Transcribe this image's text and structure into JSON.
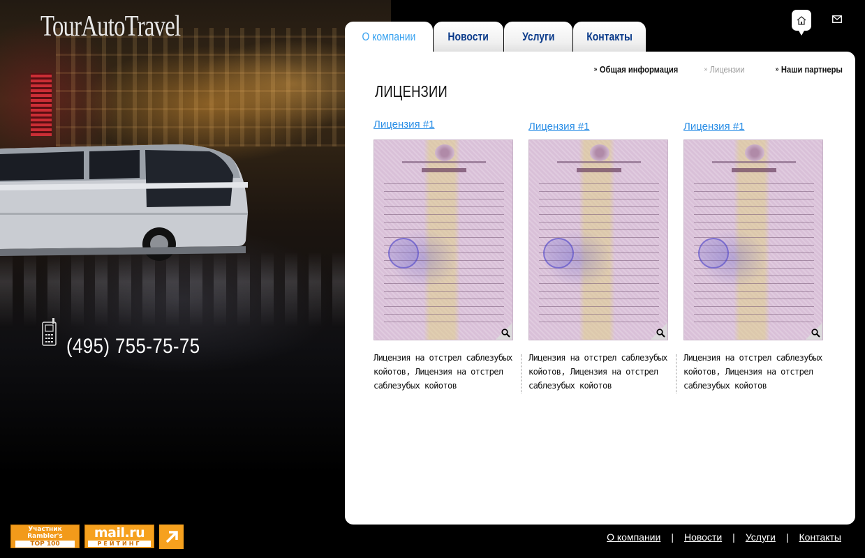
{
  "site": {
    "logo": "TourAutoTravel",
    "phone": "(495) 755-75-75"
  },
  "top_icons": {
    "home": "home-icon",
    "mail": "mail-icon"
  },
  "tabs": [
    {
      "label": "О компании",
      "active": true
    },
    {
      "label": "Новости",
      "active": false
    },
    {
      "label": "Услуги",
      "active": false
    },
    {
      "label": "Контакты",
      "active": false
    }
  ],
  "subnav": [
    {
      "label": "Общая информация",
      "active": true
    },
    {
      "label": "Лицензии",
      "active": false
    },
    {
      "label": "Наши партнеры",
      "active": true
    }
  ],
  "page": {
    "title": "ЛИЦЕНЗИИ"
  },
  "licenses": [
    {
      "link": "Лицензия #1",
      "description": "Лицензия на отстрел саблезубых койотов, Лицензия на отстрел саблезубых койотов"
    },
    {
      "link": "Лицензия #1",
      "description": "Лицензия на отстрел саблезубых койотов, Лицензия на отстрел саблезубых койотов"
    },
    {
      "link": "Лицензия #1",
      "description": "Лицензия на отстрел саблезубых койотов, Лицензия на отстрел саблезубых койотов"
    }
  ],
  "footer": {
    "nav": [
      "О компании",
      "Новости",
      "Услуги",
      "Контакты"
    ],
    "separator": "|",
    "rambler": {
      "top": "Участник",
      "mid": "Rambler's",
      "bottom": "TOP 100"
    },
    "mail": {
      "top": "mail.ru",
      "bottom": "РЕЙТИНГ"
    }
  },
  "colors": {
    "accent_blue": "#3aa3f0",
    "tab_link": "#0a3a8a",
    "badge_orange": "#f29a1a"
  }
}
